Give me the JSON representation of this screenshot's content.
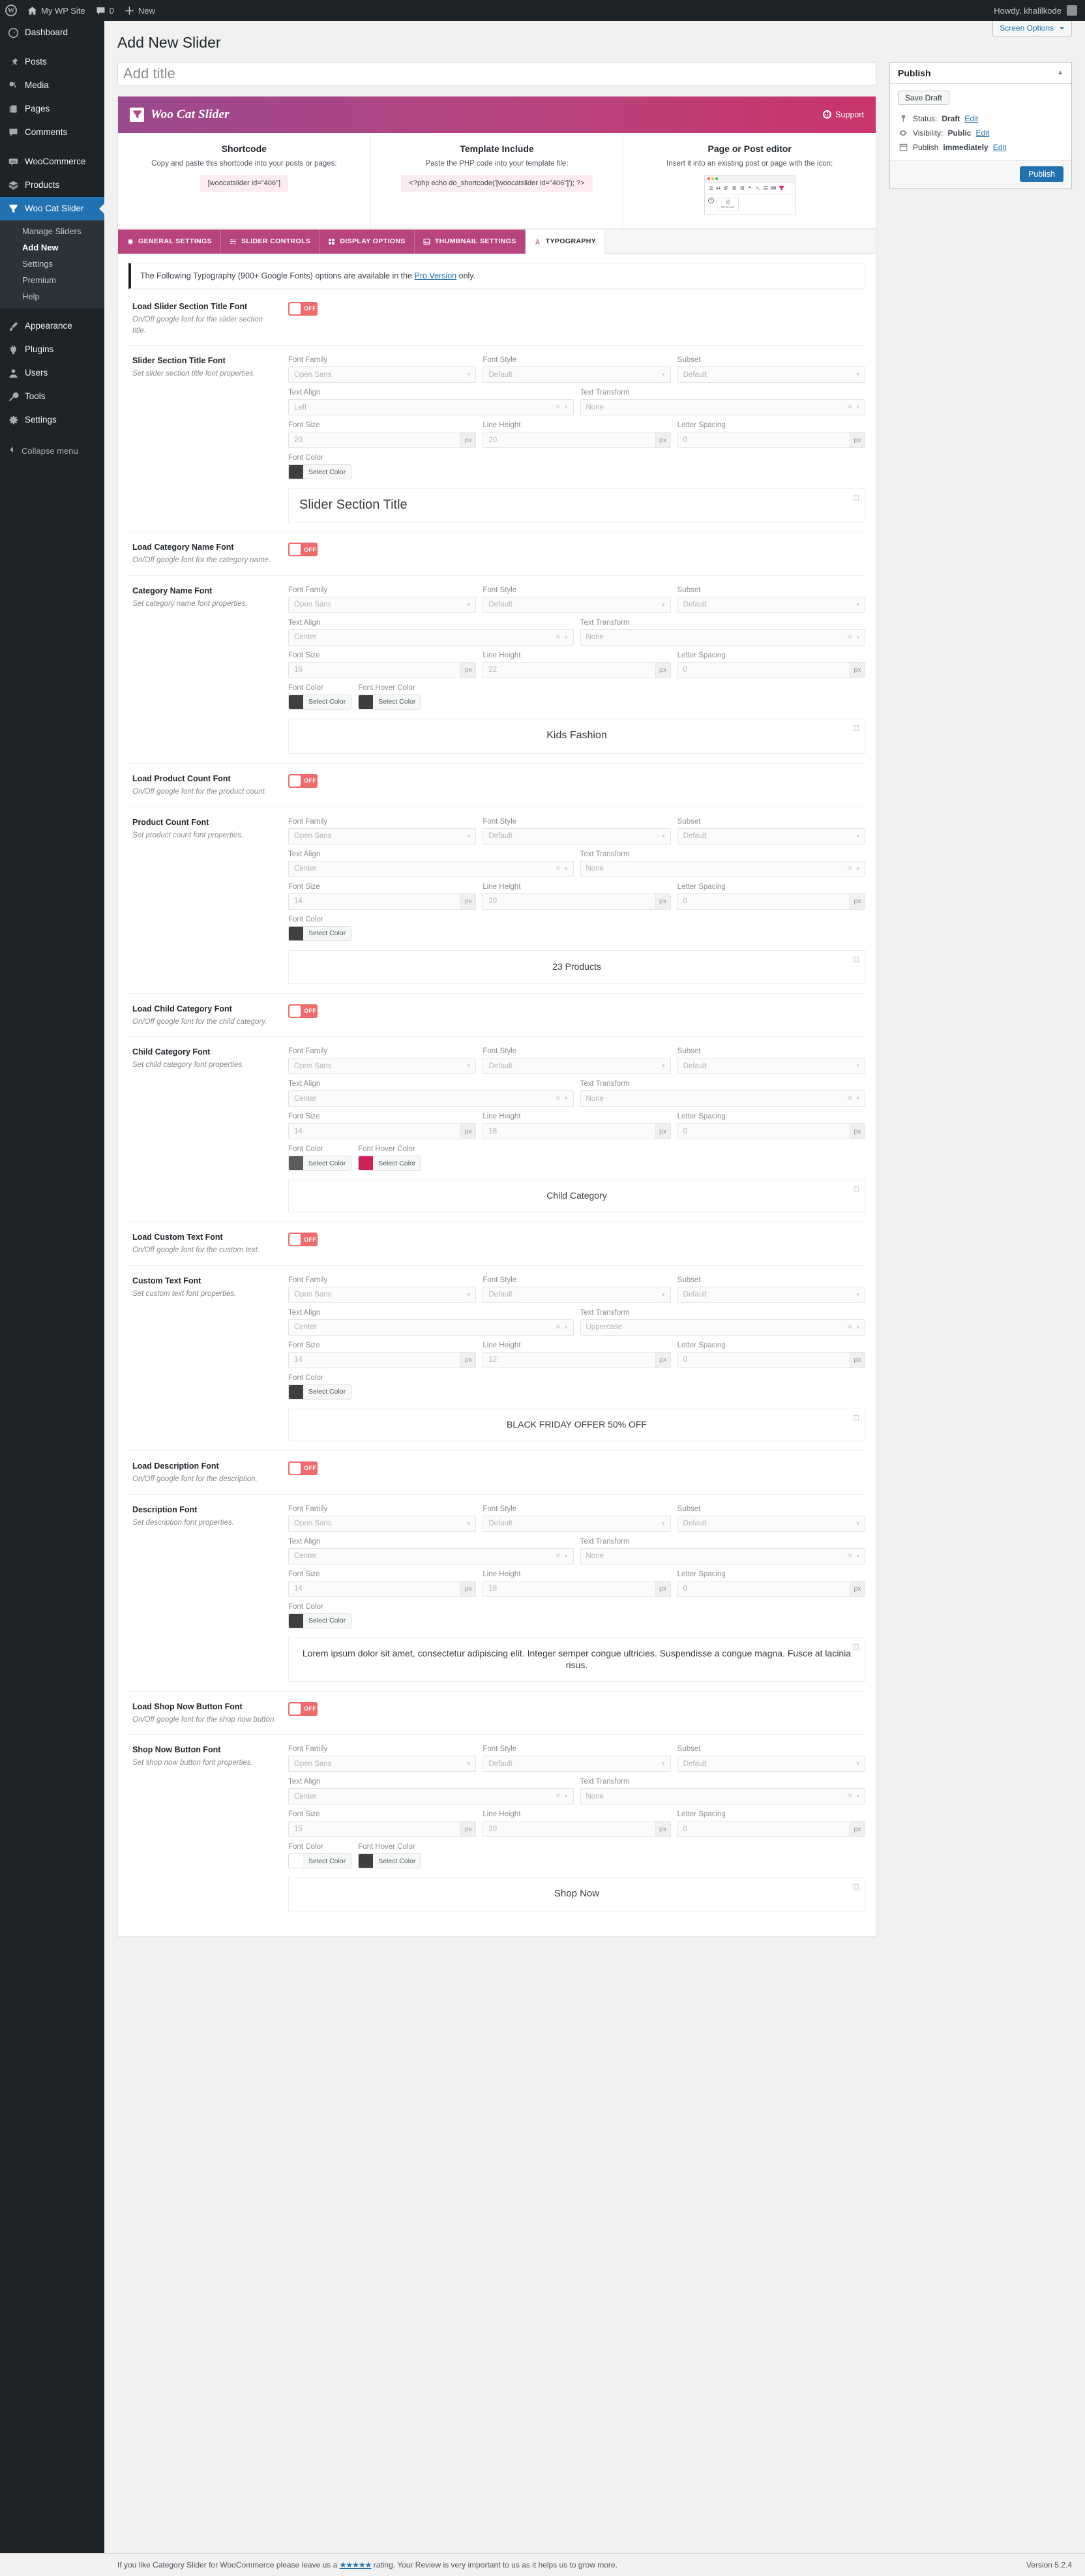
{
  "adminbar": {
    "site_name": "My WP Site",
    "comments_count": "0",
    "new_label": "New",
    "howdy": "Howdy, khalilkode"
  },
  "sidebar": {
    "items": [
      {
        "label": "Dashboard",
        "icon": "dashboard-icon"
      },
      {
        "label": "Posts",
        "icon": "pin-icon"
      },
      {
        "label": "Media",
        "icon": "media-icon"
      },
      {
        "label": "Pages",
        "icon": "pages-icon"
      },
      {
        "label": "Comments",
        "icon": "comment-icon"
      },
      {
        "label": "WooCommerce",
        "icon": "woo-icon"
      },
      {
        "label": "Products",
        "icon": "box-icon"
      },
      {
        "label": "Woo Cat Slider",
        "icon": "funnel-icon"
      },
      {
        "label": "Appearance",
        "icon": "brush-icon"
      },
      {
        "label": "Plugins",
        "icon": "plugin-icon"
      },
      {
        "label": "Users",
        "icon": "users-icon"
      },
      {
        "label": "Tools",
        "icon": "tools-icon"
      },
      {
        "label": "Settings",
        "icon": "settings-icon"
      }
    ],
    "submenu": [
      {
        "label": "Manage Sliders",
        "current": false
      },
      {
        "label": "Add New",
        "current": true
      },
      {
        "label": "Settings",
        "current": false
      },
      {
        "label": "Premium",
        "current": false
      },
      {
        "label": "Help",
        "current": false
      }
    ],
    "collapse_label": "Collapse menu"
  },
  "screen_options": {
    "label": "Screen Options"
  },
  "page": {
    "title": "Add New Slider"
  },
  "title_field": {
    "placeholder": "Add title",
    "value": ""
  },
  "plugin": {
    "name": "Woo Cat Slider",
    "support_label": "Support"
  },
  "usage": [
    {
      "title": "Shortcode",
      "desc": "Copy and paste this shortcode into your posts or pages:",
      "code": "[woocatslider id=\"406\"]"
    },
    {
      "title": "Template Include",
      "desc": "Paste the PHP code into your template file:",
      "code": "<?php echo do_shortcode('[woocatslider id=\"406\"]'); ?>"
    },
    {
      "title": "Page or Post editor",
      "desc": "Insert it into an existing post or page with the icon:",
      "code": ""
    }
  ],
  "editor_mock": {
    "shortcode_glyph": "[/]",
    "shortcode_label": "Shortcode"
  },
  "tabs": [
    {
      "label": "General Settings",
      "icon": "gear-icon",
      "active": false
    },
    {
      "label": "Slider Controls",
      "icon": "sliders-icon",
      "active": false
    },
    {
      "label": "Display Options",
      "icon": "grid-icon",
      "active": false
    },
    {
      "label": "Thumbnail Settings",
      "icon": "image-icon",
      "active": false
    },
    {
      "label": "Typography",
      "icon": "font-a-icon",
      "active": true
    }
  ],
  "notice": {
    "text_before": "The Following Typography (900+ Google Fonts) options are available in the ",
    "link": "Pro Version",
    "text_after": " only."
  },
  "field_labels": {
    "font_family": "Font Family",
    "font_style": "Font Style",
    "subset": "Subset",
    "text_align": "Text Align",
    "text_transform": "Text Transform",
    "font_size": "Font Size",
    "line_height": "Line Height",
    "letter_spacing": "Letter Spacing",
    "font_color": "Font Color",
    "font_hover_color": "Font Hover Color",
    "select_color": "Select Color",
    "unit": "px"
  },
  "sections": [
    {
      "toggle": {
        "title": "Load Slider Section Title Font",
        "desc": "On/Off google font for the slider section title.",
        "state": "OFF"
      },
      "font": {
        "title": "Slider Section Title Font",
        "desc": "Set slider section title font properties.",
        "font_family": "Open Sans",
        "font_style": "Default",
        "subset": "Default",
        "text_align": "Left",
        "text_transform": "None",
        "font_size": "20",
        "line_height": "20",
        "letter_spacing": "0",
        "font_color": "#3f3f3f",
        "hover_color": null,
        "preview": "Slider Section Title"
      }
    },
    {
      "toggle": {
        "title": "Load Category Name Font",
        "desc": "On/Off google font for the category name.",
        "state": "OFF"
      },
      "font": {
        "title": "Category Name Font",
        "desc": "Set category name font properties.",
        "font_family": "Open Sans",
        "font_style": "Default",
        "subset": "Default",
        "text_align": "Center",
        "text_transform": "None",
        "font_size": "16",
        "line_height": "22",
        "letter_spacing": "0",
        "font_color": "#3f3f3f",
        "hover_color": "#3f3f3f",
        "preview": "Kids Fashion"
      }
    },
    {
      "toggle": {
        "title": "Load Product Count Font",
        "desc": "On/Off google font for the product count.",
        "state": "OFF"
      },
      "font": {
        "title": "Product Count Font",
        "desc": "Set product count font properties.",
        "font_family": "Open Sans",
        "font_style": "Default",
        "subset": "Default",
        "text_align": "Center",
        "text_transform": "None",
        "font_size": "14",
        "line_height": "20",
        "letter_spacing": "0",
        "font_color": "#3f3f3f",
        "hover_color": null,
        "preview": "23 Products"
      }
    },
    {
      "toggle": {
        "title": "Load Child Category Font",
        "desc": "On/Off google font for the child category.",
        "state": "OFF"
      },
      "font": {
        "title": "Child Category Font",
        "desc": "Set child category font properties.",
        "font_family": "Open Sans",
        "font_style": "Default",
        "subset": "Default",
        "text_align": "Center",
        "text_transform": "None",
        "font_size": "14",
        "line_height": "18",
        "letter_spacing": "0",
        "font_color": "#5b5b5b",
        "hover_color": "#cc2255",
        "preview": "Child Category"
      }
    },
    {
      "toggle": {
        "title": "Load Custom Text Font",
        "desc": "On/Off google font for the custom text.",
        "state": "OFF"
      },
      "font": {
        "title": "Custom Text Font",
        "desc": "Set custom text font properties.",
        "font_family": "Open Sans",
        "font_style": "Default",
        "subset": "Default",
        "text_align": "Center",
        "text_transform": "Uppercase",
        "font_size": "14",
        "line_height": "12",
        "letter_spacing": "0",
        "font_color": "#3f3f3f",
        "hover_color": null,
        "preview": "Black Friday Offer 50% Off"
      }
    },
    {
      "toggle": {
        "title": "Load Description Font",
        "desc": "On/Off google font for the description.",
        "state": "OFF"
      },
      "font": {
        "title": "Description Font",
        "desc": "Set description font properties.",
        "font_family": "Open Sans",
        "font_style": "Default",
        "subset": "Default",
        "text_align": "Center",
        "text_transform": "None",
        "font_size": "14",
        "line_height": "18",
        "letter_spacing": "0",
        "font_color": "#3f3f3f",
        "hover_color": null,
        "preview": "Lorem ipsum dolor sit amet, consectetur adipiscing elit. Integer semper congue ultricies. Suspendisse a congue magna. Fusce at lacinia risus."
      }
    },
    {
      "toggle": {
        "title": "Load Shop Now Button Font",
        "desc": "On/Off google font for the shop now button.",
        "state": "OFF"
      },
      "font": {
        "title": "Shop Now Button Font",
        "desc": "Set shop now button font properties.",
        "font_family": "Open Sans",
        "font_style": "Default",
        "subset": "Default",
        "text_align": "Center",
        "text_transform": "None",
        "font_size": "15",
        "line_height": "20",
        "letter_spacing": "0",
        "font_color": "#ffffff",
        "hover_color": "#3f3f3f",
        "preview": "Shop Now"
      }
    }
  ],
  "publish": {
    "heading": "Publish",
    "save_draft": "Save Draft",
    "status_label": "Status:",
    "status_value": "Draft",
    "visibility_label": "Visibility:",
    "visibility_value": "Public",
    "schedule_label": "Publish",
    "schedule_value": "immediately",
    "edit_label": "Edit",
    "publish_button": "Publish"
  },
  "footer": {
    "text_before": "If you like Category Slider for WooCommerce please leave us a ",
    "stars": "★★★★★",
    "text_after": " rating. Your Review is very important to us as it helps us to grow more.",
    "version": "Version 5.2.4"
  },
  "colors": {
    "brand_pink": "#b8447e",
    "brand_purple": "#9a4a8e",
    "toggle_off": "#ef6b6b",
    "wp_blue": "#2271b1",
    "hover_crimson": "#cc2255"
  }
}
